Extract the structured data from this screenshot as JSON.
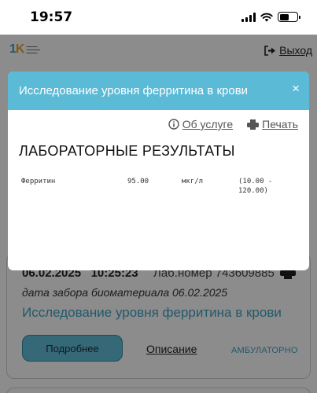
{
  "status_bar": {
    "time": "19:57"
  },
  "header": {
    "logout_label": "Выход"
  },
  "modal": {
    "title": "Исследование уровня ферритина в крови",
    "close_label": "×",
    "about_service_label": "Об услуге",
    "print_label": "Печать",
    "heading": "ЛАБОРАТОРНЫЕ РЕЗУЛЬТАТЫ",
    "results": [
      {
        "name": "Ферритин",
        "value": "95.00",
        "unit": "мкг/л",
        "reference": "(10.00 - 120.00)"
      }
    ]
  },
  "background_card": {
    "date": "06.02.2025",
    "time": "10:25:23",
    "lab_number": "Лаб.номер 743609885",
    "biomaterial_date": "дата забора биоматериала 06.02.2025",
    "title": "Исследование уровня ферритина в крови",
    "details_button": "Подробнее",
    "description_link": "Описание",
    "visit_type": "АМБУЛАТОРНО"
  },
  "colors": {
    "accent": "#5bbad6",
    "link": "#3ea3c4",
    "button": "#62bfd9"
  }
}
